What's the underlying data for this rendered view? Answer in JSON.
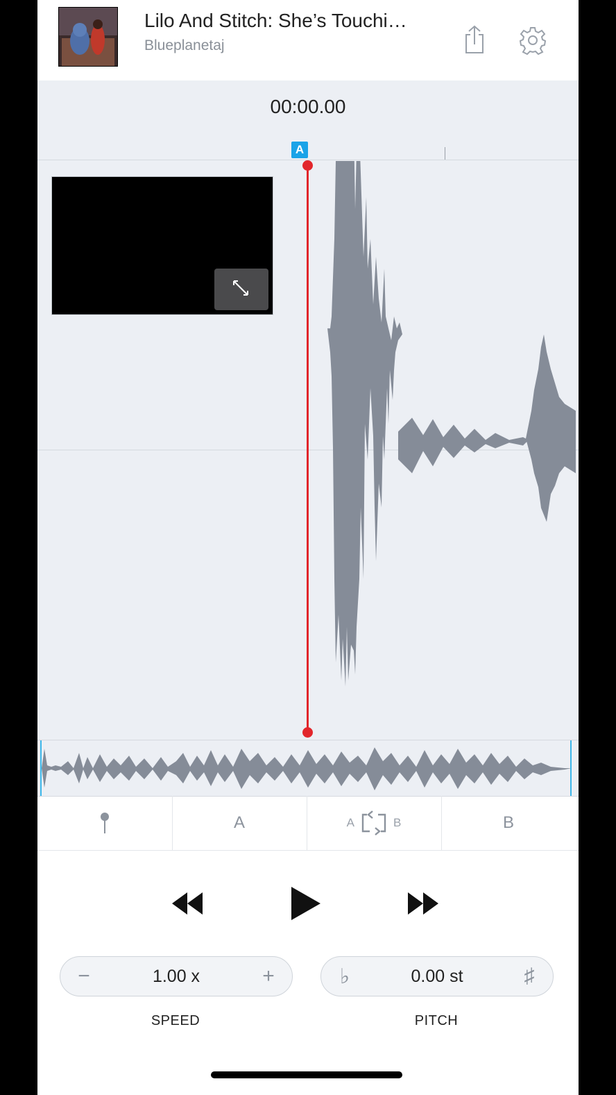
{
  "header": {
    "title": "Lilo And Stitch: She’s Touchi…",
    "subtitle": "Blueplanetaj",
    "thumbnail_icon": "album-art-thumbnail",
    "share_icon": "share-icon",
    "settings_icon": "gear-icon"
  },
  "waveform": {
    "time": "00:00.00",
    "a_marker": "A",
    "playhead_color": "#e2262b",
    "wave_color": "#858c98"
  },
  "ab_bar": {
    "pin_icon": "pin-icon",
    "a_label": "A",
    "loop_a": "A",
    "loop_b": "B",
    "b_label": "B"
  },
  "transport": {
    "rewind_icon": "rewind-icon",
    "play_icon": "play-icon",
    "forward_icon": "fast-forward-icon"
  },
  "speed": {
    "minus": "−",
    "value": "1.00 x",
    "plus": "+",
    "label": "SPEED"
  },
  "pitch": {
    "flat": "♭",
    "value": "0.00 st",
    "sharp": "♯",
    "label": "PITCH"
  },
  "colors": {
    "accent": "#1aa3e8",
    "playhead": "#e2262b",
    "background": "#eceff4"
  }
}
